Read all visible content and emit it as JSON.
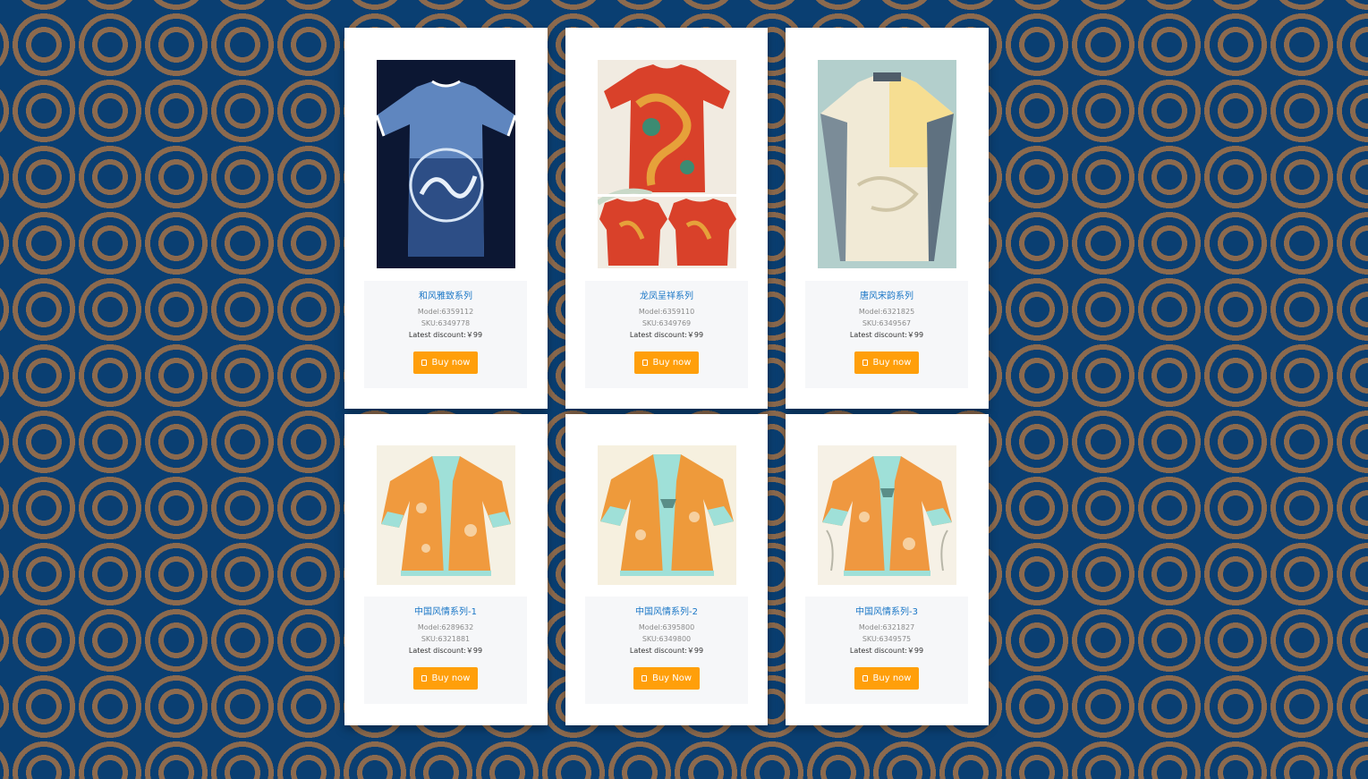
{
  "colors": {
    "background": "#0a3f72",
    "pattern_rings": "#8c6a4e",
    "card": "#ffffff",
    "info_panel": "#f6f7f9",
    "title": "#1976c6",
    "button": "#ff9f0a"
  },
  "products": [
    {
      "name": "和风雅致系列",
      "model": "Model:6359112",
      "sku": "SKU:6349778",
      "discount": "Latest discount:￥99",
      "button_label": "Buy now",
      "button_icon": "cart-icon",
      "image": "navy-blue-dragon-tshirt"
    },
    {
      "name": "龙凤呈祥系列",
      "model": "Model:6359110",
      "sku": "SKU:6349769",
      "discount": "Latest discount:￥99",
      "button_label": "Buy now",
      "button_icon": "cart-icon",
      "image": "red-golden-dragon-tshirt"
    },
    {
      "name": "唐风宋韵系列",
      "model": "Model:6321825",
      "sku": "SKU:6349567",
      "discount": "Latest discount:￥99",
      "button_label": "Buy now",
      "button_icon": "cart-icon",
      "image": "cream-yellow-tang-shirt"
    },
    {
      "name": "中国风情系列-1",
      "model": "Model:6289632",
      "sku": "SKU:6321881",
      "discount": "Latest discount:￥99",
      "button_label": "Buy now",
      "button_icon": "cart-icon",
      "image": "orange-teal-robe"
    },
    {
      "name": "中国风情系列-2",
      "model": "Model:6395800",
      "sku": "SKU:6349800",
      "discount": "Latest discount:￥99",
      "button_label": "Buy Now",
      "button_icon": "cart-icon",
      "image": "orange-teal-robe"
    },
    {
      "name": "中国风情系列-3",
      "model": "Model:6321827",
      "sku": "SKU:6349575",
      "discount": "Latest discount:￥99",
      "button_label": "Buy now",
      "button_icon": "cart-icon",
      "image": "orange-teal-robe"
    }
  ]
}
